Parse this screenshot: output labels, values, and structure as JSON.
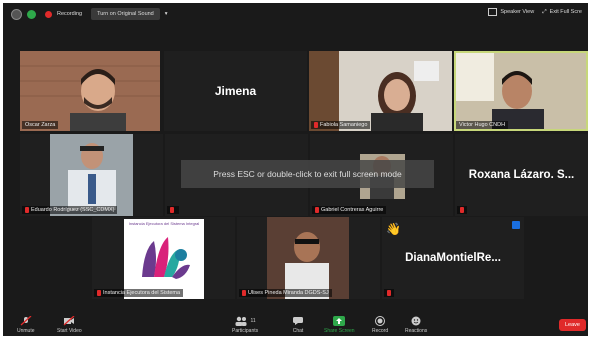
{
  "topbar": {
    "recording_label": "Recording",
    "sound_button": "Turn on Original Sound",
    "speaker_view": "Speaker View",
    "exit_full_screen": "Exit Full Scre"
  },
  "tiles": [
    {
      "name": "Oscar Zarza",
      "type": "video"
    },
    {
      "name": "Jimena",
      "type": "name-only"
    },
    {
      "name": "Fabiola Samaniego",
      "type": "video"
    },
    {
      "name": "Victor Hugo CNDH",
      "type": "video",
      "active": true
    },
    {
      "name": "Eduardo Rodríguez (SSC_CDMX)",
      "type": "video"
    },
    {
      "name": "",
      "type": "name-only"
    },
    {
      "name": "Gabriel Contreras Aguirre",
      "type": "video"
    },
    {
      "name": "Roxana Lázaro. S...",
      "type": "name-only"
    },
    {
      "name": "Instancia Ejecutora del Sistema",
      "type": "logo",
      "logo_text": "Instancia Ejecutora del Sistema Integral"
    },
    {
      "name": "Ulises Pineda Miranda DGDS-SJ",
      "type": "video"
    },
    {
      "name": "DianaMontielRe...",
      "type": "name-only",
      "reaction": "👋"
    }
  ],
  "overlay_text": "Press ESC or double-click to exit full screen mode",
  "controls": {
    "unmute": "Unmute",
    "start_video": "Start Video",
    "participants": "Participants",
    "participants_count": "11",
    "chat": "Chat",
    "share_screen": "Share Screen",
    "record": "Record",
    "reactions": "Reactions",
    "leave": "Leave"
  },
  "colors": {
    "accent_green": "#2ea84a",
    "mute_red": "#e02a2a",
    "active_border": "#c7d77a"
  }
}
